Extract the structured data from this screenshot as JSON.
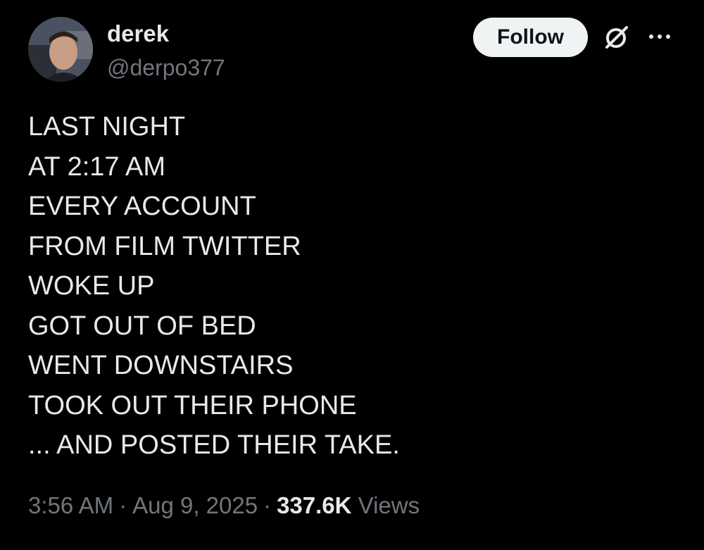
{
  "author": {
    "name": "derek",
    "handle": "@derpo377"
  },
  "actions": {
    "follow_label": "Follow",
    "grok_icon": "grok-icon",
    "more_icon": "more-icon"
  },
  "tweet": {
    "lines": [
      "LAST NIGHT",
      "AT 2:17 AM",
      "EVERY ACCOUNT",
      "FROM FILM TWITTER",
      "WOKE UP",
      "GOT OUT OF BED",
      "WENT DOWNSTAIRS",
      "TOOK OUT THEIR PHONE",
      "... AND POSTED THEIR TAKE."
    ]
  },
  "meta": {
    "time": "3:56 AM",
    "separator": "·",
    "date": "Aug 9, 2025",
    "views_count": "337.6K",
    "views_label": "Views"
  },
  "colors": {
    "background": "#000000",
    "primary_text": "#e7e9ea",
    "secondary_text": "#71767b",
    "follow_bg": "#eff3f4"
  }
}
